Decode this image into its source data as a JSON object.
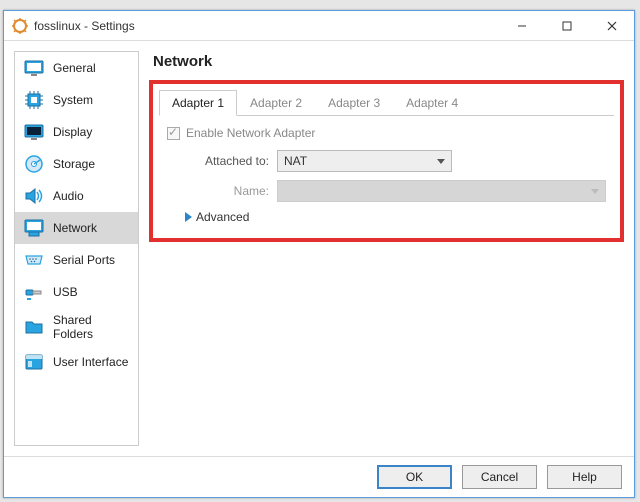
{
  "window": {
    "title": "fosslinux - Settings"
  },
  "sidebar": {
    "items": [
      {
        "label": "General"
      },
      {
        "label": "System"
      },
      {
        "label": "Display"
      },
      {
        "label": "Storage"
      },
      {
        "label": "Audio"
      },
      {
        "label": "Network"
      },
      {
        "label": "Serial Ports"
      },
      {
        "label": "USB"
      },
      {
        "label": "Shared Folders"
      },
      {
        "label": "User Interface"
      }
    ],
    "selected_index": 5
  },
  "page": {
    "title": "Network",
    "tabs": [
      {
        "label": "Adapter 1"
      },
      {
        "label": "Adapter 2"
      },
      {
        "label": "Adapter 3"
      },
      {
        "label": "Adapter 4"
      }
    ],
    "active_tab_index": 0,
    "enable_label": "Enable Network Adapter",
    "enable_checked": true,
    "attached_to_label": "Attached to:",
    "attached_to_value": "NAT",
    "name_label": "Name:",
    "name_value": "",
    "advanced_label": "Advanced"
  },
  "footer": {
    "ok": "OK",
    "cancel": "Cancel",
    "help": "Help"
  }
}
